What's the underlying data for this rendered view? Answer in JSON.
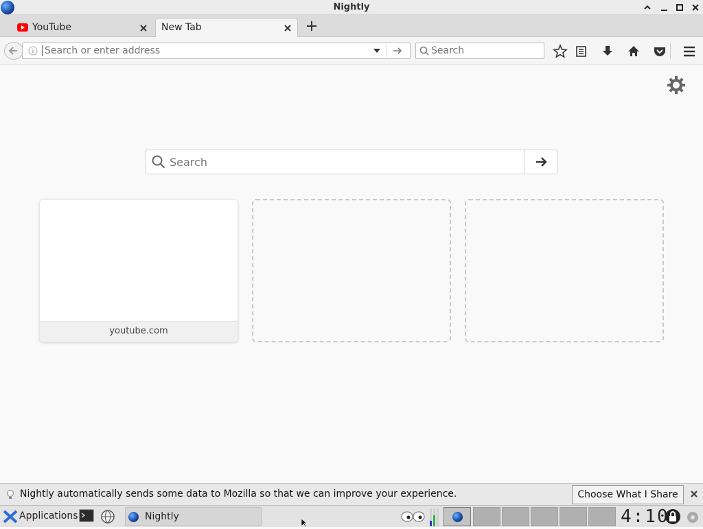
{
  "window": {
    "title": "Nightly",
    "controls": [
      "minimize",
      "maximize-restore",
      "maximize",
      "close"
    ]
  },
  "tabs": [
    {
      "label": "YouTube",
      "icon": "youtube-icon",
      "active": false
    },
    {
      "label": "New Tab",
      "icon": "",
      "active": true
    }
  ],
  "navbar": {
    "url_placeholder": "Search or enter address",
    "search_placeholder": "Search"
  },
  "newtab": {
    "search_placeholder": "Search",
    "tiles": [
      {
        "caption": "youtube.com",
        "filled": true
      },
      {
        "caption": "",
        "filled": false
      },
      {
        "caption": "",
        "filled": false
      }
    ]
  },
  "notification": {
    "message": "Nightly automatically sends some data to Mozilla so that we can improve your experience.",
    "button": "Choose What I Share"
  },
  "taskbar": {
    "menu_label": "Applications",
    "task_label": "Nightly",
    "clock": "4:10"
  },
  "colors": {
    "youtube_red": "#ff0000",
    "nightly_blue": "#1a4ea8"
  }
}
